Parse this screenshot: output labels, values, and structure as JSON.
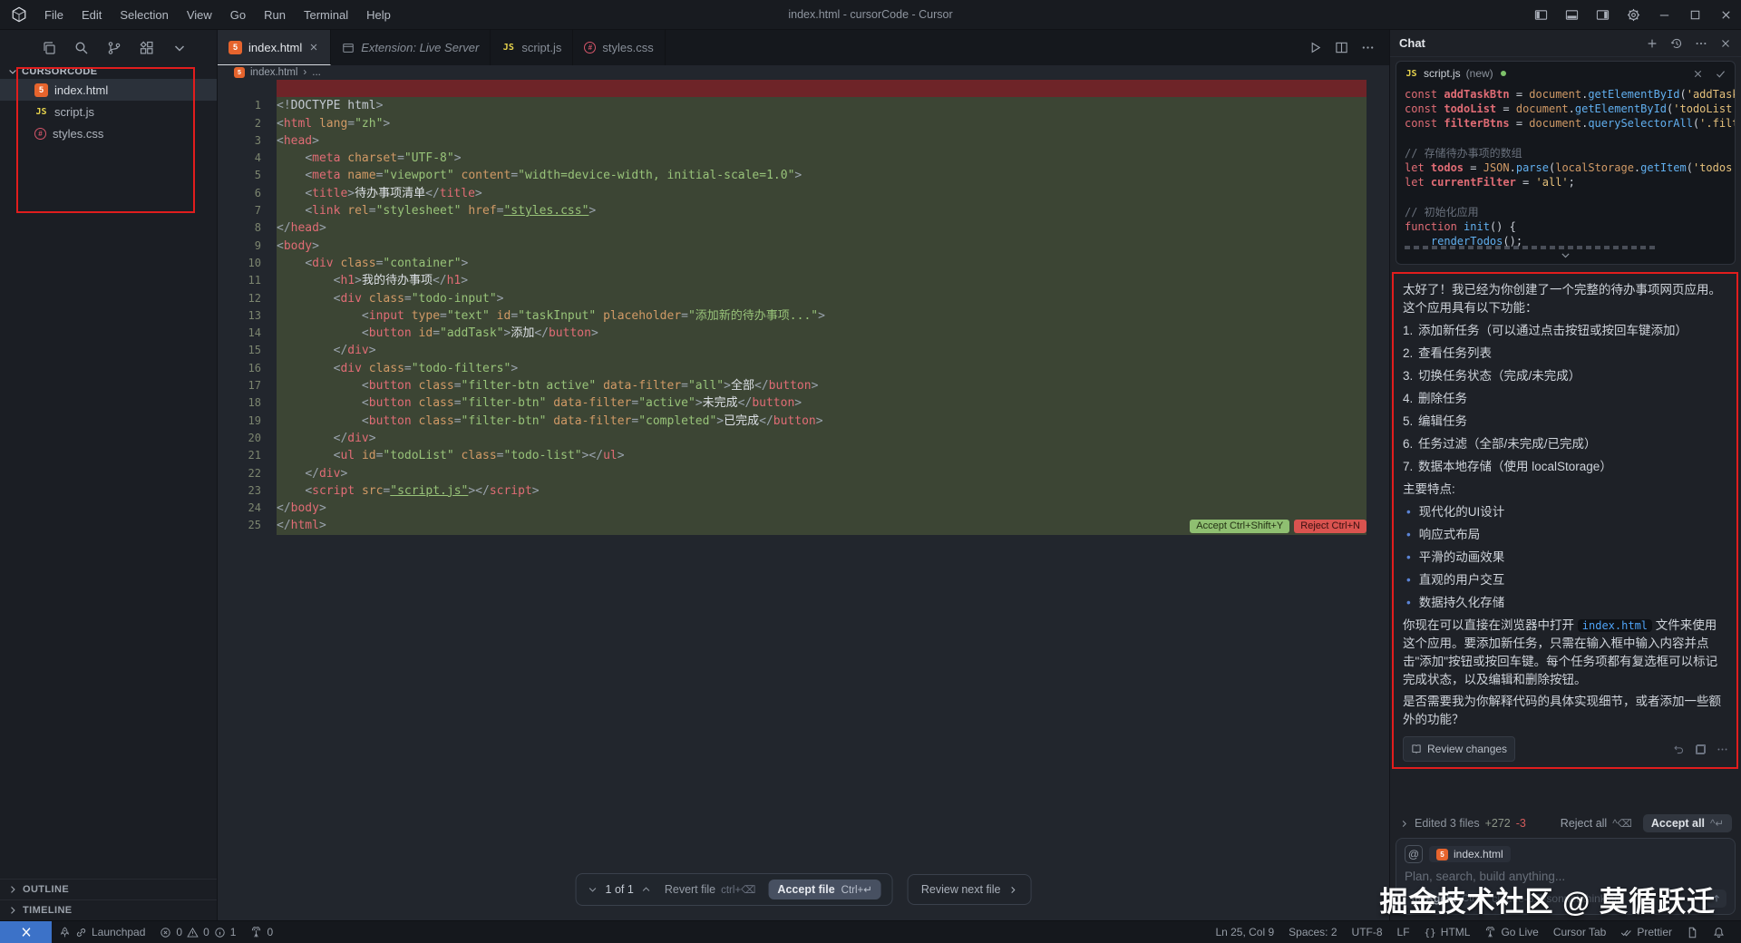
{
  "title_bar": {
    "title": "index.html - cursorCode - Cursor",
    "menus": [
      "File",
      "Edit",
      "Selection",
      "View",
      "Go",
      "Run",
      "Terminal",
      "Help"
    ]
  },
  "sidebar": {
    "root": "CURSORCODE",
    "files": [
      {
        "name": "index.html",
        "icon": "html",
        "active": true
      },
      {
        "name": "script.js",
        "icon": "js",
        "active": false
      },
      {
        "name": "styles.css",
        "icon": "css",
        "active": false
      }
    ],
    "panels": [
      "OUTLINE",
      "TIMELINE"
    ]
  },
  "tabs": [
    {
      "label": "index.html",
      "icon": "html",
      "active": true,
      "closable": true
    },
    {
      "label": "Extension: Live Server",
      "icon": "window",
      "preview": true
    },
    {
      "label": "script.js",
      "icon": "js"
    },
    {
      "label": "styles.css",
      "icon": "css"
    }
  ],
  "editor": {
    "breadcrumb": {
      "file": "index.html",
      "sep": "›",
      "more": "..."
    },
    "accept_chip": "Accept Ctrl+Shift+Y",
    "reject_chip": "Reject Ctrl+N",
    "code_lines": [
      "<!DOCTYPE html>",
      "<html lang=\"zh\">",
      "<head>",
      "    <meta charset=\"UTF-8\">",
      "    <meta name=\"viewport\" content=\"width=device-width, initial-scale=1.0\">",
      "    <title>待办事项清单</title>",
      "    <link rel=\"stylesheet\" href=\"styles.css\">",
      "</head>",
      "<body>",
      "    <div class=\"container\">",
      "        <h1>我的待办事项</h1>",
      "        <div class=\"todo-input\">",
      "            <input type=\"text\" id=\"taskInput\" placeholder=\"添加新的待办事项...\">",
      "            <button id=\"addTask\">添加</button>",
      "        </div>",
      "        <div class=\"todo-filters\">",
      "            <button class=\"filter-btn active\" data-filter=\"all\">全部</button>",
      "            <button class=\"filter-btn\" data-filter=\"active\">未完成</button>",
      "            <button class=\"filter-btn\" data-filter=\"completed\">已完成</button>",
      "        </div>",
      "        <ul id=\"todoList\" class=\"todo-list\"></ul>",
      "    </div>",
      "    <script src=\"script.js\"></script>",
      "</body>",
      "</html>"
    ]
  },
  "review_bar": {
    "nav": "1 of 1",
    "revert": "Revert file",
    "revert_kbd": "ctrl+⌫",
    "accept": "Accept file",
    "accept_kbd": "Ctrl+↵",
    "next": "Review next file"
  },
  "chat": {
    "title": "Chat",
    "code_card": {
      "file": "script.js",
      "suffix": "(new)",
      "lines": [
        [
          [
            "const ",
            "kw"
          ],
          [
            "addTaskBtn",
            "vr"
          ],
          [
            " = ",
            "cpn"
          ],
          [
            "document",
            "ob"
          ],
          [
            ".",
            "cpn"
          ],
          [
            "getElementById",
            "fn"
          ],
          [
            "(",
            "cpn"
          ],
          [
            "'addTask'",
            "st"
          ],
          [
            ")",
            "cpn"
          ]
        ],
        [
          [
            "const ",
            "kw"
          ],
          [
            "todoList",
            "vr"
          ],
          [
            " = ",
            "cpn"
          ],
          [
            "document",
            "ob"
          ],
          [
            ".",
            "cpn"
          ],
          [
            "getElementById",
            "fn"
          ],
          [
            "(",
            "cpn"
          ],
          [
            "'todoList'",
            "st"
          ],
          [
            ");",
            "cpn"
          ]
        ],
        [
          [
            "const ",
            "kw"
          ],
          [
            "filterBtns",
            "vr"
          ],
          [
            " = ",
            "cpn"
          ],
          [
            "document",
            "ob"
          ],
          [
            ".",
            "cpn"
          ],
          [
            "querySelectorAll",
            "fn"
          ],
          [
            "(",
            "cpn"
          ],
          [
            "'.filter",
            "st"
          ]
        ],
        [],
        [
          [
            "// 存储待办事项的数组",
            "cm"
          ]
        ],
        [
          [
            "let ",
            "kw"
          ],
          [
            "todos",
            "vr"
          ],
          [
            " = ",
            "cpn"
          ],
          [
            "JSON",
            "ob"
          ],
          [
            ".",
            "cpn"
          ],
          [
            "parse",
            "fn"
          ],
          [
            "(",
            "cpn"
          ],
          [
            "localStorage",
            "ob"
          ],
          [
            ".",
            "cpn"
          ],
          [
            "getItem",
            "fn"
          ],
          [
            "(",
            "cpn"
          ],
          [
            "'todos'",
            "st"
          ],
          [
            "))",
            "cpn"
          ]
        ],
        [
          [
            "let ",
            "kw"
          ],
          [
            "currentFilter",
            "vr"
          ],
          [
            " = ",
            "cpn"
          ],
          [
            "'all'",
            "st"
          ],
          [
            ";",
            "cpn"
          ]
        ],
        [],
        [
          [
            "// 初始化应用",
            "cm"
          ]
        ],
        [
          [
            "function ",
            "kw"
          ],
          [
            "init",
            "fn"
          ],
          [
            "() {",
            "cpn"
          ]
        ],
        [
          [
            "    ",
            "cpn"
          ],
          [
            "renderTodos",
            "fn"
          ],
          [
            "();",
            "cpn"
          ]
        ]
      ]
    },
    "response": {
      "intro": "太好了！我已经为你创建了一个完整的待办事项网页应用。这个应用具有以下功能：",
      "numbered": [
        "添加新任务（可以通过点击按钮或按回车键添加）",
        "查看任务列表",
        "切换任务状态（完成/未完成）",
        "删除任务",
        "编辑任务",
        "任务过滤（全部/未完成/已完成）",
        "数据本地存储（使用 localStorage）"
      ],
      "features_title": "主要特点:",
      "features": [
        "现代化的UI设计",
        "响应式布局",
        "平滑的动画效果",
        "直观的用户交互",
        "数据持久化存储"
      ],
      "usage_pre": "你现在可以直接在浏览器中打开 ",
      "usage_code": "index.html",
      "usage_post": " 文件来使用这个应用。要添加新任务，只需在输入框中输入内容并点击\"添加\"按钮或按回车键。每个任务项都有复选框可以标记完成状态，以及编辑和删除按钮。",
      "question": "是否需要我为你解释代码的具体实现细节，或者添加一些额外的功能？",
      "review_changes": "Review changes"
    },
    "edited": {
      "label": "Edited 3 files",
      "added": "+272",
      "removed": "-3",
      "reject": "Reject all",
      "reject_kbd": "^⌫",
      "accept": "Accept all",
      "accept_kbd": "^↵"
    },
    "input": {
      "at": "@",
      "context_file": "index.html",
      "placeholder": "Plan, search, build anything...",
      "agent_infinity": "∞",
      "agent": "Agent",
      "agent_kbd": "Ctrl",
      "model": "claude-3.7-sonnet-thinking"
    }
  },
  "status_bar": {
    "launchpad": "Launchpad",
    "errors": "0",
    "warnings": "0",
    "infos": "1",
    "ports": "0",
    "right": [
      {
        "name": "cursor-position",
        "label": "Ln 25, Col 9"
      },
      {
        "name": "indentation",
        "label": "Spaces: 2"
      },
      {
        "name": "encoding",
        "label": "UTF-8"
      },
      {
        "name": "eol",
        "label": "LF"
      },
      {
        "name": "language-mode",
        "icon": "braces",
        "label": "HTML"
      },
      {
        "name": "go-live",
        "icon": "tower",
        "label": "Go Live"
      },
      {
        "name": "cursor-tab",
        "label": "Cursor Tab"
      },
      {
        "name": "prettier",
        "icon": "dcheck",
        "label": "Prettier"
      },
      {
        "name": "editor-layout",
        "icon": "doc",
        "label": ""
      },
      {
        "name": "notifications",
        "icon": "bell",
        "label": ""
      }
    ]
  },
  "watermark": "掘金技术社区 @ 莫循跃迁"
}
